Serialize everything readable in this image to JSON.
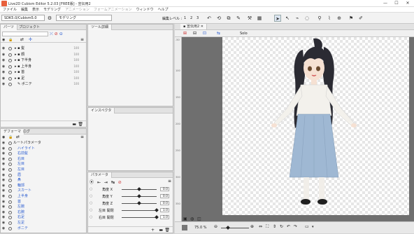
{
  "window": {
    "title": "Live2D Cubism Editor 5.2.03 [FREE版] - 宣伝用2",
    "minimize": "—",
    "maximize": "☐",
    "close": "✕"
  },
  "menu": [
    "ファイル",
    "編集",
    "表示",
    "モデリング",
    "アニメーション",
    "フォームアニメーション",
    "ウィンドウ",
    "ヘルプ"
  ],
  "toolbar": {
    "version_select": "SDK5.0/Cubism5.0",
    "mode_select": "モデリング",
    "edit_level_label": "編集レベル :",
    "edit_level_values": [
      "1",
      "2",
      "3"
    ]
  },
  "parts_panel": {
    "tabs": [
      "パーツ",
      "プロジェクト"
    ],
    "items": [
      {
        "label": "髪",
        "num": "100"
      },
      {
        "label": "顔",
        "num": "100"
      },
      {
        "label": "下半身",
        "num": "100"
      },
      {
        "label": "上半身",
        "num": "100"
      },
      {
        "label": "首",
        "num": "100"
      },
      {
        "label": "足",
        "num": "100"
      },
      {
        "label": "ボニテ",
        "num": "100"
      }
    ]
  },
  "deformer_panel": {
    "tabs": [
      "デフォーマ",
      "ログ"
    ],
    "items": [
      "ルートパラメータ",
      "ハイライト",
      "右前髪",
      "右目",
      "左目",
      "左目",
      "眉",
      "鼻",
      "輪郭",
      "スカート",
      "上半身",
      "首",
      "左腕",
      "右腕",
      "右足",
      "左足",
      "ボニテ"
    ]
  },
  "tool_details": {
    "tab": "ツール詳細"
  },
  "inspector": {
    "tab": "インスペクタ"
  },
  "params_panel": {
    "tab": "パラメータ",
    "rows": [
      {
        "label": "角度 X",
        "value": "0.0",
        "fraction": 0.5
      },
      {
        "label": "角度 Y",
        "value": "0.0",
        "fraction": 0.5
      },
      {
        "label": "角度 Z",
        "value": "0.0",
        "fraction": 0.5
      },
      {
        "label": "左目 開閉",
        "value": "1.0",
        "fraction": 1.0
      },
      {
        "label": "右目 開閉",
        "value": "1.0",
        "fraction": 1.0
      }
    ]
  },
  "canvas": {
    "tab": "宣伝用2",
    "solo_label": "Solo",
    "zoom": "75.0 %",
    "ruler_marks": [
      "-50",
      "100",
      "150",
      "200",
      "250",
      "300",
      "350"
    ]
  },
  "colors": {
    "accent_blue": "#2a5cd0",
    "skirt": "#9fb8d3",
    "hair": "#2b2b33",
    "blouse": "#f3f1ec"
  }
}
